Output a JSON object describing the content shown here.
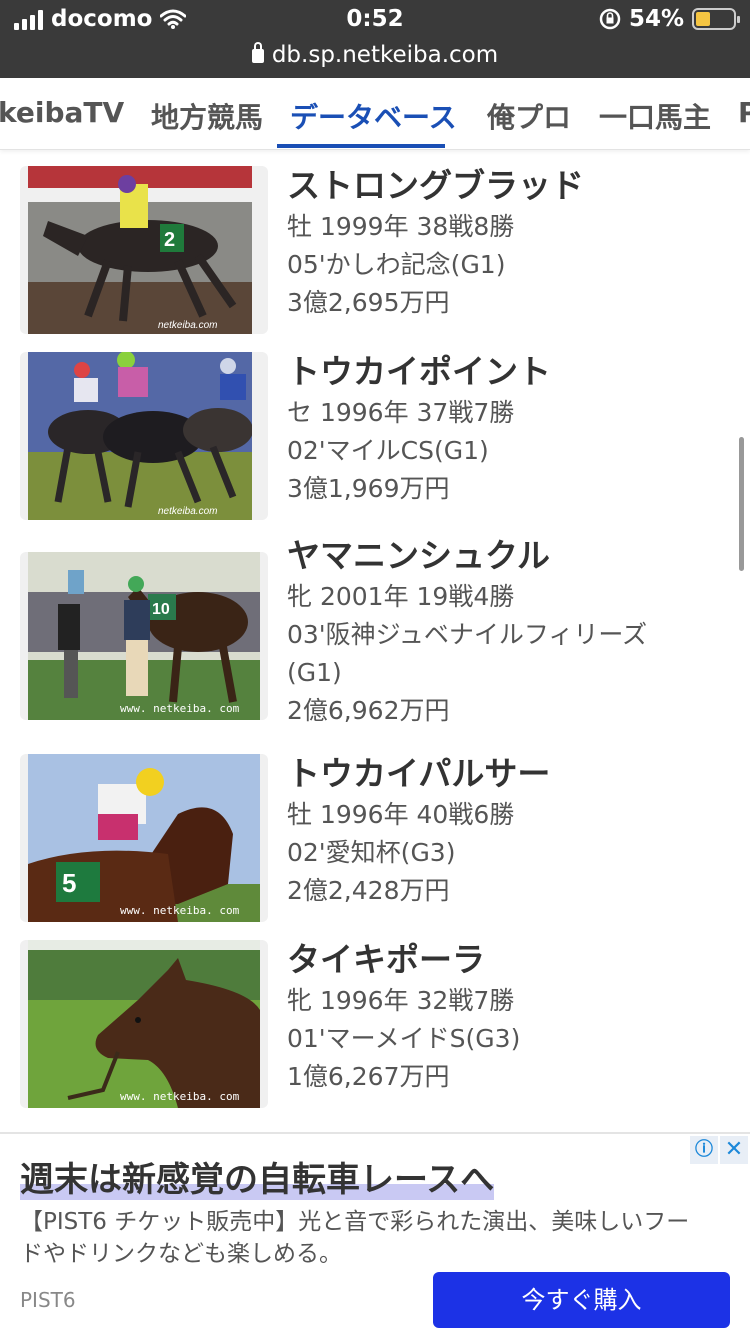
{
  "status_bar": {
    "carrier": "docomo",
    "time": "0:52",
    "battery": "54%"
  },
  "url_bar": {
    "url": "db.sp.netkeiba.com"
  },
  "tabs": [
    {
      "label": "keibaTV"
    },
    {
      "label": "地方競馬"
    },
    {
      "label": "データベース"
    },
    {
      "label": "俺プロ"
    },
    {
      "label": "一口馬主"
    },
    {
      "label": "P"
    }
  ],
  "horses": [
    {
      "name": "ストロングブラッド",
      "profile": "牡 1999年 38戦8勝",
      "race": "05'かしわ記念(G1)",
      "race_cont": "",
      "earnings": "3億2,695万円",
      "watermark": "netkeiba.com"
    },
    {
      "name": "トウカイポイント",
      "profile": "セ 1996年 37戦7勝",
      "race": "02'マイルCS(G1)",
      "race_cont": "",
      "earnings": "3億1,969万円",
      "watermark": "netkeiba.com"
    },
    {
      "name": "ヤマニンシュクル",
      "profile": "牝 2001年 19戦4勝",
      "race": "03'阪神ジュベナイルフィリーズ",
      "race_cont": "(G1)",
      "earnings": "2億6,962万円",
      "watermark": "www. netkeiba. com"
    },
    {
      "name": "トウカイパルサー",
      "profile": "牡 1996年 40戦6勝",
      "race": "02'愛知杯(G3)",
      "race_cont": "",
      "earnings": "2億2,428万円",
      "watermark": "www. netkeiba. com"
    },
    {
      "name": "タイキポーラ",
      "profile": "牝 1996年 32戦7勝",
      "race": "01'マーメイドS(G3)",
      "race_cont": "",
      "earnings": "1億6,267万円",
      "watermark": "www. netkeiba. com"
    }
  ],
  "ad": {
    "title": "週末は新感覚の自転車レースへ",
    "description": "【PIST6 チケット販売中】光と音で彩られた演出、美味しいフードやドリンクなども楽しめる。",
    "brand": "PIST6",
    "cta": "今すぐ購入"
  },
  "colors": {
    "accent": "#1a4fb5",
    "ad_button": "#1c32e6",
    "status_bar_bg": "#3a3a3a"
  }
}
